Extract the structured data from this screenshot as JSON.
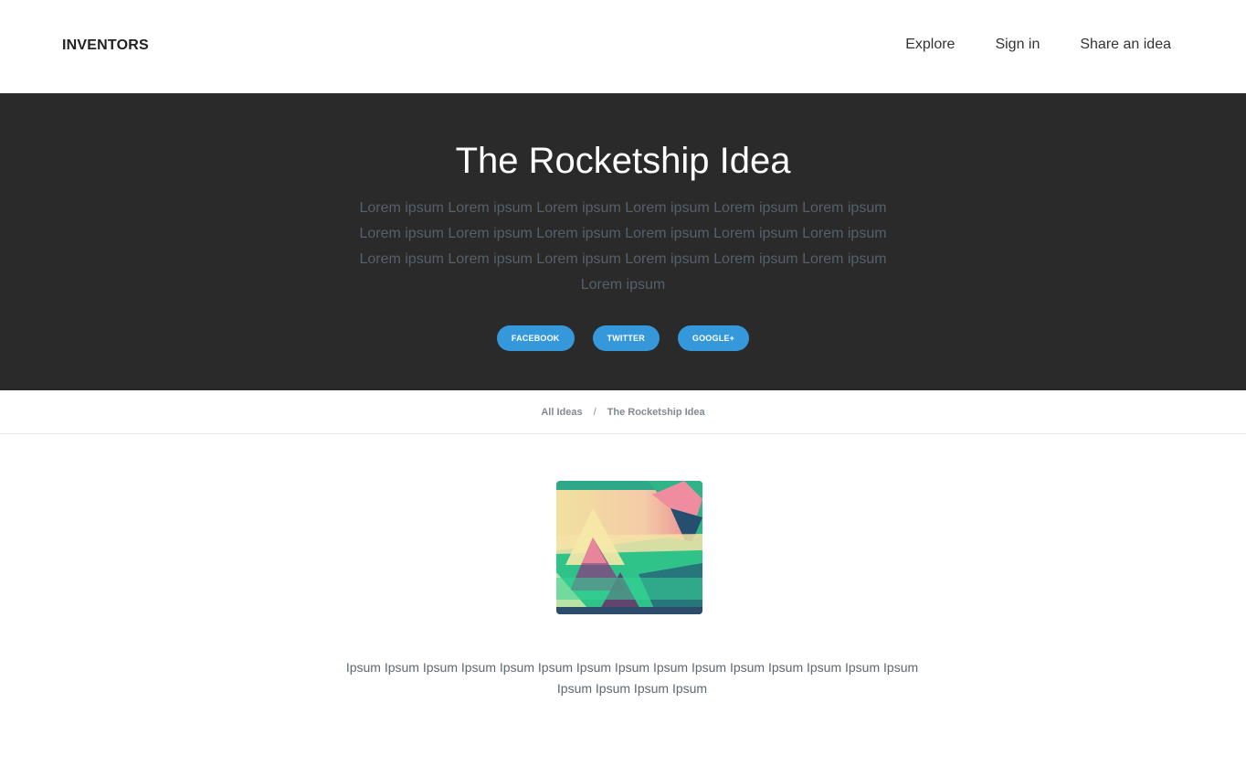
{
  "header": {
    "brand": "INVENTORS",
    "nav": [
      "Explore",
      "Sign in",
      "Share an idea"
    ]
  },
  "hero": {
    "title": "The Rocketship Idea",
    "description": "Lorem ipsum Lorem ipsum Lorem ipsum Lorem ipsum Lorem ipsum Lorem ipsum Lorem ipsum Lorem ipsum Lorem ipsum Lorem ipsum Lorem ipsum Lorem ipsum Lorem ipsum Lorem ipsum Lorem ipsum Lorem ipsum Lorem ipsum Lorem ipsum Lorem ipsum",
    "share_buttons": [
      "FACEBOOK",
      "TWITTER",
      "GOOGLE+"
    ],
    "accent_color": "#3498db",
    "background_color": "#2a2a2a"
  },
  "breadcrumb": {
    "items": [
      "All Ideas",
      "The Rocketship Idea"
    ],
    "separator": "/"
  },
  "content": {
    "body": "Ipsum Ipsum Ipsum Ipsum Ipsum Ipsum Ipsum Ipsum Ipsum Ipsum Ipsum Ipsum Ipsum Ipsum Ipsum Ipsum Ipsum Ipsum Ipsum"
  }
}
